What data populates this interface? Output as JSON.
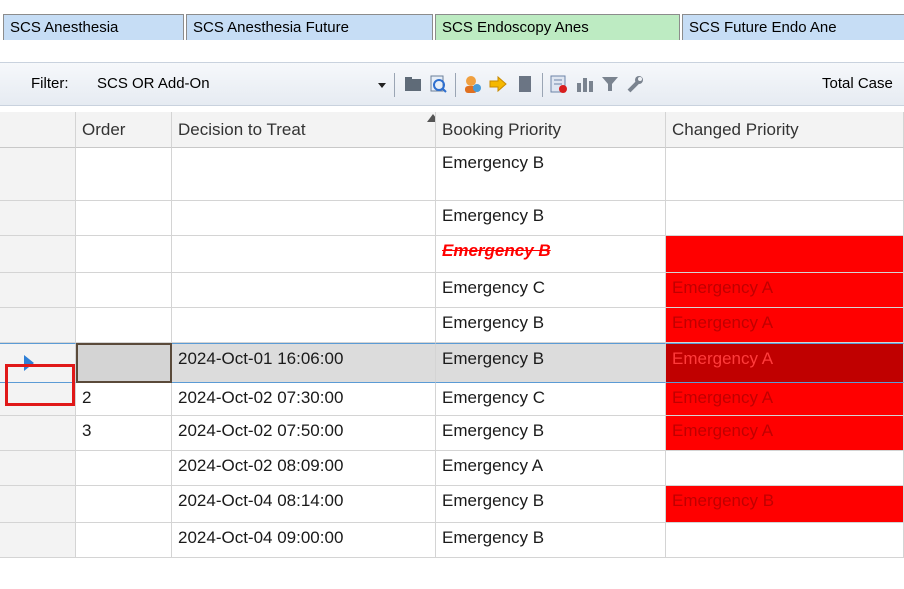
{
  "tabs": [
    {
      "label": "SCS Anesthesia",
      "color": "blue"
    },
    {
      "label": "SCS Anesthesia Future",
      "color": "blue"
    },
    {
      "label": "SCS Endoscopy Anes",
      "color": "green"
    },
    {
      "label": "SCS Future Endo Ane",
      "color": "blue"
    }
  ],
  "toolbar": {
    "filter_label": "Filter:",
    "filter_value": "SCS OR Add-On",
    "total_label": "Total Case",
    "icons": [
      "folder-icon",
      "search-refresh-icon",
      "user-icon",
      "arrow-right-icon",
      "document-icon",
      "checklist-icon",
      "bar-chart-icon",
      "filter-icon",
      "wrench-icon"
    ]
  },
  "grid": {
    "columns": [
      "Order",
      "Decision to Treat",
      "Booking Priority",
      "Changed Priority"
    ],
    "rows": [
      {
        "order": "",
        "decision": "",
        "booking": "Emergency B",
        "changed": "",
        "changed_highlight": false
      },
      {
        "order": "",
        "decision": "",
        "booking": "Emergency B",
        "changed": "",
        "changed_highlight": false
      },
      {
        "order": "",
        "decision": "",
        "booking": "Emergency B",
        "booking_struck": true,
        "changed": "",
        "changed_highlight": true
      },
      {
        "order": "",
        "decision": "",
        "booking": "Emergency C",
        "changed": "Emergency A",
        "changed_highlight": true
      },
      {
        "order": "",
        "decision": "",
        "booking": "Emergency B",
        "changed": "Emergency A",
        "changed_highlight": true
      },
      {
        "order": "",
        "decision": "2024-Oct-01 16:06:00",
        "booking": "Emergency B",
        "changed": "Emergency A",
        "changed_highlight": true,
        "current": true
      },
      {
        "order": "2",
        "decision": "2024-Oct-02 07:30:00",
        "booking": "Emergency C",
        "changed": "Emergency A",
        "changed_highlight": true
      },
      {
        "order": "3",
        "decision": "2024-Oct-02 07:50:00",
        "booking": "Emergency B",
        "changed": "Emergency A",
        "changed_highlight": true
      },
      {
        "order": "",
        "decision": "2024-Oct-02 08:09:00",
        "booking": "Emergency A",
        "changed": "",
        "changed_highlight": false
      },
      {
        "order": "",
        "decision": "2024-Oct-04 08:14:00",
        "booking": "Emergency B",
        "changed": "Emergency B",
        "changed_highlight": true
      },
      {
        "order": "",
        "decision": "2024-Oct-04 09:00:00",
        "booking": "Emergency B",
        "changed": "",
        "changed_highlight": false
      }
    ]
  },
  "colors": {
    "tab_blue": "#c6ddf5",
    "tab_green": "#bdebc2",
    "changed_red": "#ff0000",
    "current_row_red": "#c00000",
    "row_pointer": "#2e7fd6",
    "annotation_box": "#e01818"
  }
}
